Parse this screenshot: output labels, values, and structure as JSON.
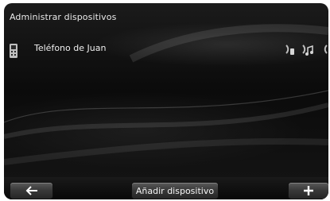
{
  "screen": {
    "title": "Administrar dispositivos"
  },
  "devices": [
    {
      "name": "Teléfono de Juan",
      "type_icon": "phone-icon",
      "status_icons": [
        "handsfree-phone-icon",
        "audio-streaming-icon",
        "partial-icon"
      ]
    }
  ],
  "toolbar": {
    "back_icon": "arrow-left-icon",
    "add_device_label": "Añadir dispositivo",
    "plus_icon": "plus-icon"
  },
  "colors": {
    "background": "#0f0f0f",
    "text": "#e9e9e9",
    "button": "#3a3a3a"
  }
}
